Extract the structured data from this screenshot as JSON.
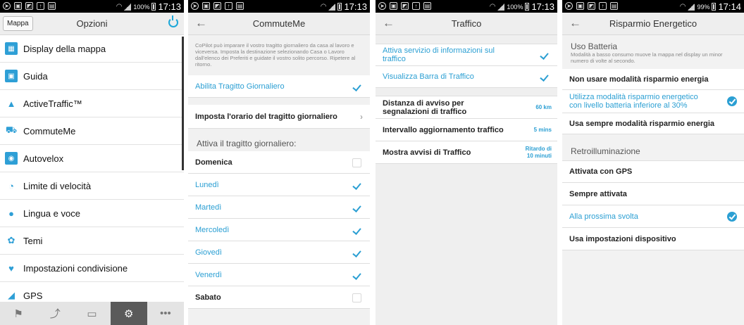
{
  "status": {
    "p1": {
      "battery": "100%",
      "time": "17:13"
    },
    "p2": {
      "battery": "",
      "time": "17:13"
    },
    "p3": {
      "battery": "100%",
      "time": "17:13"
    },
    "p4": {
      "battery": "99%",
      "time": "17:14"
    }
  },
  "options": {
    "mappa_button": "Mappa",
    "title": "Opzioni",
    "items": [
      {
        "label": "Display della mappa",
        "icon": "map-display-icon"
      },
      {
        "label": "Guida",
        "icon": "guide-icon"
      },
      {
        "label": "ActiveTraffic™",
        "icon": "traffic-warning-icon"
      },
      {
        "label": "CommuteMe",
        "icon": "commute-car-icon"
      },
      {
        "label": "Autovelox",
        "icon": "speed-camera-icon"
      },
      {
        "label": "Limite di velocità",
        "icon": "speedometer-icon"
      },
      {
        "label": "Lingua e voce",
        "icon": "speech-bubble-icon"
      },
      {
        "label": "Temi",
        "icon": "palette-icon"
      },
      {
        "label": "Impostazioni condivisione",
        "icon": "twitter-icon"
      },
      {
        "label": "GPS",
        "icon": "satellite-icon"
      }
    ],
    "tabs": [
      "flag-icon",
      "route-icon",
      "contact-card-icon",
      "settings-gears-icon",
      "more-dots-icon"
    ]
  },
  "commute": {
    "title": "CommuteMe",
    "description": "CoPilot può imparare il vostro tragitto giornaliero da casa al lavoro e viceversa. Imposta la destinazione selezionando Casa o Lavoro dall'elenco dei Preferiti e guidate il vostro solito percorso. Ripetere al ritorno.",
    "enable_label": "Abilita Tragitto Giornaliero",
    "set_time_label": "Imposta l'orario del tragitto giornaliero",
    "section_label": "Attiva il tragitto giornaliero:",
    "days": [
      {
        "label": "Domenica",
        "checked": false
      },
      {
        "label": "Lunedì",
        "checked": true
      },
      {
        "label": "Martedì",
        "checked": true
      },
      {
        "label": "Mercoledì",
        "checked": true
      },
      {
        "label": "Giovedì",
        "checked": true
      },
      {
        "label": "Venerdì",
        "checked": true
      },
      {
        "label": "Sabato",
        "checked": false
      }
    ]
  },
  "traffic": {
    "title": "Traffico",
    "toggles": [
      {
        "label": "Attiva servizio di informazioni sul traffico",
        "checked": true
      },
      {
        "label": "Visualizza Barra di Traffico",
        "checked": true
      }
    ],
    "settings": [
      {
        "label": "Distanza di avviso per segnalazioni di traffico",
        "value": "60 km"
      },
      {
        "label": "Intervallo aggiornamento traffico",
        "value": "5 mins"
      },
      {
        "label": "Mostra avvisi di Traffico",
        "value": "Ritardo di 10 minuti"
      }
    ]
  },
  "energy": {
    "title": "Risparmio Energetico",
    "battery_section": "Uso Batteria",
    "battery_desc": "Modalità a basso consumo muove la mappa nel display un minor numero di volte al secondo.",
    "battery_options": [
      {
        "label": "Non usare modalità risparmio energia",
        "selected": false
      },
      {
        "label": "Utilizza modalità risparmio energetico con livello batteria inferiore al 30%",
        "selected": true
      },
      {
        "label": "Usa sempre modalità risparmio energia",
        "selected": false
      }
    ],
    "backlight_section": "Retroilluminazione",
    "backlight_options": [
      {
        "label": "Attivata con GPS",
        "selected": false
      },
      {
        "label": "Sempre attivata",
        "selected": false
      },
      {
        "label": "Alla prossima svolta",
        "selected": true
      },
      {
        "label": "Usa impostazioni dispositivo",
        "selected": false
      }
    ]
  },
  "colors": {
    "accent": "#2b9fd3",
    "statusbar": "#000000",
    "appbar": "#eeeeee"
  }
}
